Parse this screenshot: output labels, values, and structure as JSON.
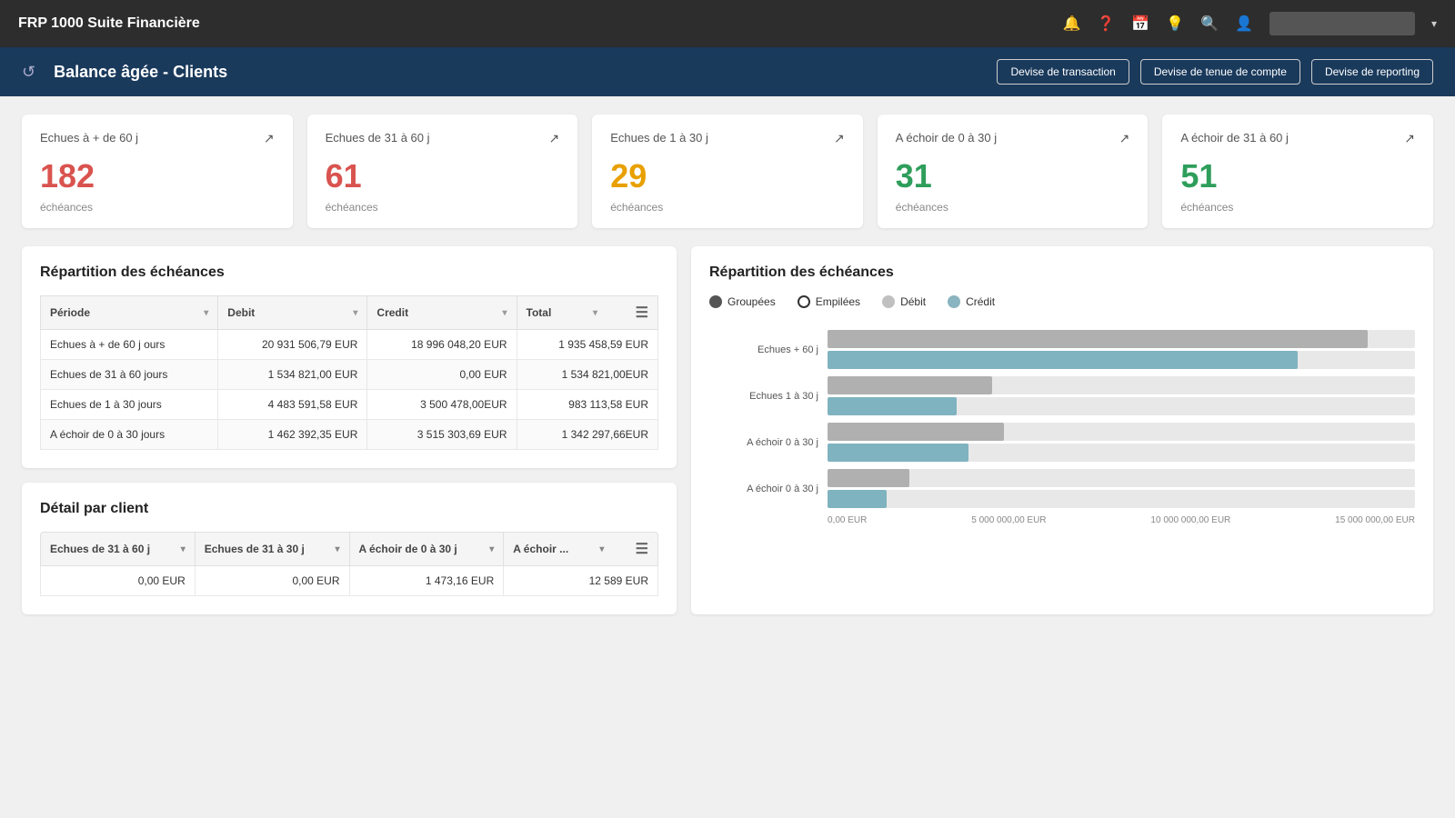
{
  "topnav": {
    "title": "FRP 1000 Suite Financière",
    "search_placeholder": "",
    "icons": [
      "bell",
      "question",
      "calendar",
      "bulb",
      "search",
      "user"
    ]
  },
  "subheader": {
    "title": "Balance âgée - Clients",
    "buttons": [
      "Devise de transaction",
      "Devise de tenue de compte",
      "Devise de reporting"
    ]
  },
  "kpi_cards": [
    {
      "label": "Echues à + de 60 j",
      "value": "182",
      "sub": "échéances",
      "color": "red"
    },
    {
      "label": "Echues de 31 à  60 j",
      "value": "61",
      "sub": "échéances",
      "color": "red"
    },
    {
      "label": "Echues de 1 à 30 j",
      "value": "29",
      "sub": "échéances",
      "color": "orange"
    },
    {
      "label": "A échoir de 0 à 30 j",
      "value": "31",
      "sub": "échéances",
      "color": "green"
    },
    {
      "label": "A échoir de 31 à 60 j",
      "value": "51",
      "sub": "échéances",
      "color": "green"
    }
  ],
  "repartition_table": {
    "title": "Répartition des échéances",
    "columns": [
      "Période",
      "Debit",
      "Credit",
      "Total"
    ],
    "rows": [
      {
        "periode": "Echues à + de 60 j ours",
        "debit": "20 931 506,79 EUR",
        "credit": "18 996 048,20 EUR",
        "total": "1 935 458,59 EUR"
      },
      {
        "periode": "Echues de 31 à  60 jours",
        "debit": "1 534 821,00 EUR",
        "credit": "0,00 EUR",
        "total": "1 534 821,00EUR"
      },
      {
        "periode": "Echues de 1 à 30 jours",
        "debit": "4 483 591,58 EUR",
        "credit": "3 500 478,00EUR",
        "total": "983 113,58 EUR"
      },
      {
        "periode": "A échoir de 0 à 30 jours",
        "debit": "1 462 392,35 EUR",
        "credit": "3 515 303,69 EUR",
        "total": "1 342 297,66EUR"
      }
    ]
  },
  "chart": {
    "title": "Répartition des échéances",
    "legend": [
      "Groupées",
      "Empilées",
      "Débit",
      "Crédit"
    ],
    "rows": [
      {
        "label": "Echues + 60 j",
        "debit_pct": 92,
        "credit_pct": 80
      },
      {
        "label": "Echues 1 à  30 j",
        "debit_pct": 28,
        "credit_pct": 22
      },
      {
        "label": "A échoir 0 à 30 j",
        "debit_pct": 30,
        "credit_pct": 24
      },
      {
        "label": "A échoir 0 à 30 j",
        "debit_pct": 14,
        "credit_pct": 10
      }
    ],
    "axis_labels": [
      "0,00 EUR",
      "5 000 000,00 EUR",
      "10 000 000,00 EUR",
      "15 000 000,00 EUR"
    ]
  },
  "detail_table": {
    "title": "Détail par client",
    "columns": [
      "Echues de 31 à  60 j",
      "Echues de 31 à  30 j",
      "A échoir de 0 à 30 j",
      "A échoir ..."
    ],
    "rows": [
      {
        "c1": "0,00 EUR",
        "c2": "0,00 EUR",
        "c3": "1 473,16 EUR",
        "c4": "12 589 EUR"
      }
    ]
  }
}
